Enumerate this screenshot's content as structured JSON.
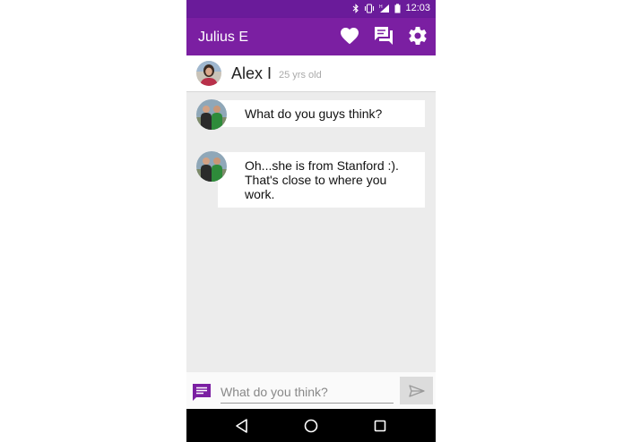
{
  "status_bar": {
    "time": "12:03"
  },
  "app_bar": {
    "title": "Julius E",
    "icons": [
      "heart-icon",
      "chat-icon",
      "gear-icon"
    ]
  },
  "profile": {
    "name": "Alex I",
    "age": "25 yrs old"
  },
  "messages": [
    {
      "text": "What do you guys think?"
    },
    {
      "text": "Oh...she is from Stanford :). That's close to where you work."
    }
  ],
  "composer": {
    "placeholder": "What do you think?",
    "value": ""
  },
  "navigation": [
    "back-icon",
    "home-icon",
    "recents-icon"
  ],
  "colors": {
    "primary": "#7b1fa2",
    "primary_dark": "#6a1b9a",
    "background": "#ececec",
    "bubble": "#ffffff"
  }
}
